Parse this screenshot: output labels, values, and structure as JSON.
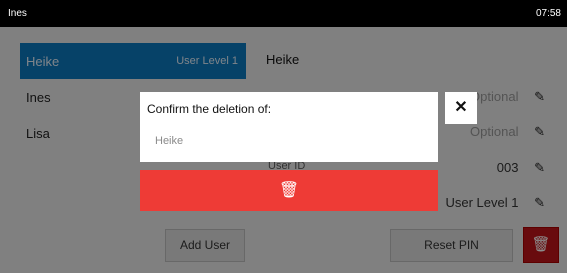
{
  "status_bar": {
    "user": "Ines",
    "time": "07:58"
  },
  "users_list": [
    {
      "name": "Heike",
      "level": "User Level 1",
      "selected": true
    },
    {
      "name": "Ines",
      "selected": false
    },
    {
      "name": "Lisa",
      "selected": false
    }
  ],
  "user_details": {
    "name": "Heike",
    "field_1_value": "Optional",
    "field_2_value": "Optional",
    "user_id_label": "User ID",
    "user_id_value": "003",
    "level_value": "User Level 1"
  },
  "buttons": {
    "add_user": "Add User",
    "reset_pin": "Reset PIN"
  },
  "dialog": {
    "title": "Confirm the deletion of:",
    "target": "Heike"
  },
  "icons": {
    "close": "close-icon",
    "edit": "pencil-icon",
    "delete": "trash-icon"
  },
  "colors": {
    "accent_blue": "#0b79be",
    "delete_red": "#ee3b36",
    "dark_red": "#c0151b"
  }
}
